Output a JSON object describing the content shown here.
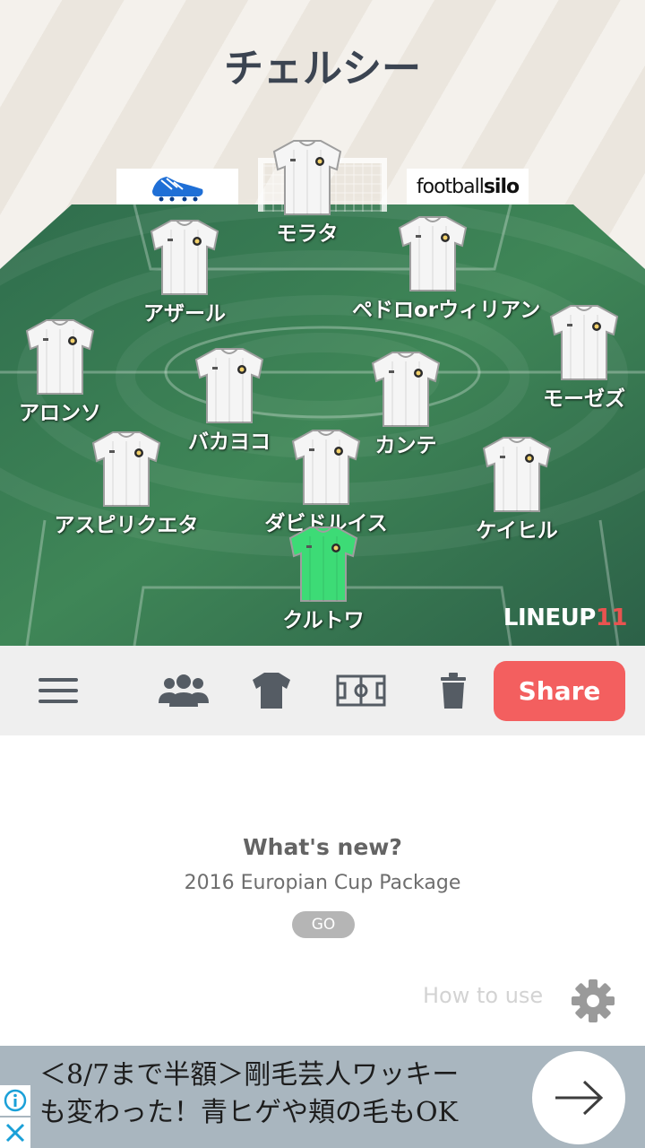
{
  "lineup": {
    "team_name": "チェルシー",
    "players": [
      {
        "name": "モラタ",
        "kit": "outfield"
      },
      {
        "name": "アザール",
        "kit": "outfield"
      },
      {
        "name": "ペドロorウィリアン",
        "kit": "outfield"
      },
      {
        "name": "アロンソ",
        "kit": "outfield"
      },
      {
        "name": "モーゼズ",
        "kit": "outfield"
      },
      {
        "name": "バカヨコ",
        "kit": "outfield"
      },
      {
        "name": "カンテ",
        "kit": "outfield"
      },
      {
        "name": "アスピリクエタ",
        "kit": "outfield"
      },
      {
        "name": "ダビドルイス",
        "kit": "outfield"
      },
      {
        "name": "ケイヒル",
        "kit": "outfield"
      },
      {
        "name": "クルトワ",
        "kit": "goalkeeper"
      }
    ],
    "sponsor_right": {
      "pre": "football",
      "bold": "silo"
    },
    "brand": {
      "pre": "LINEUP",
      "accent": "11"
    },
    "colors": {
      "pitch_dark": "#2e6b4c",
      "pitch_light": "#4f9a62",
      "shirt": "#f5f5f5",
      "gk_shirt": "#3ddb76"
    }
  },
  "toolbar": {
    "icons": [
      "menu-icon",
      "players-icon",
      "shirt-icon",
      "formation-icon",
      "trash-icon"
    ],
    "share_label": "Share",
    "share_color": "#f35f5f"
  },
  "whats_new": {
    "title": "What's new?",
    "description": "2016 Europian Cup Package",
    "go_label": "GO"
  },
  "help": {
    "how_to_use_label": "How to use"
  },
  "ad": {
    "line1": "＜8/7まで半額＞剛毛芸人ワッキー",
    "line2": "も変わった！青ヒゲや頬の毛もOK"
  }
}
